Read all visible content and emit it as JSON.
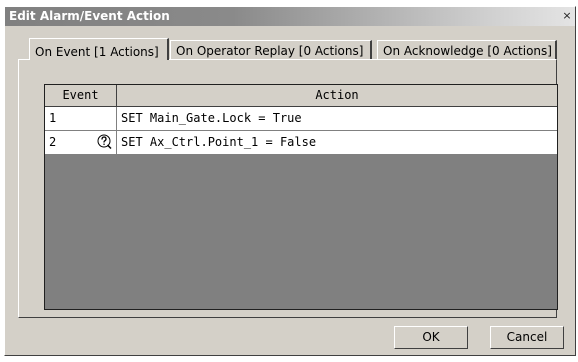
{
  "window": {
    "title": "Edit Alarm/Event Action",
    "close_label": "×"
  },
  "tabs": [
    {
      "label": "On Event [1 Actions]",
      "active": true
    },
    {
      "label": "On Operator Replay [0 Actions]",
      "active": false
    },
    {
      "label": "On Acknowledge [0 Actions]",
      "active": false
    }
  ],
  "grid": {
    "columns": [
      "Event",
      "Action"
    ],
    "rows": [
      {
        "event": "1",
        "action": "SET Main_Gate.Lock = True",
        "icon": null
      },
      {
        "event": "2",
        "action": "SET Ax_Ctrl.Point_1 = False",
        "icon": "question-mark-icon"
      }
    ]
  },
  "buttons": {
    "ok_label": "OK",
    "cancel_label": "Cancel"
  }
}
